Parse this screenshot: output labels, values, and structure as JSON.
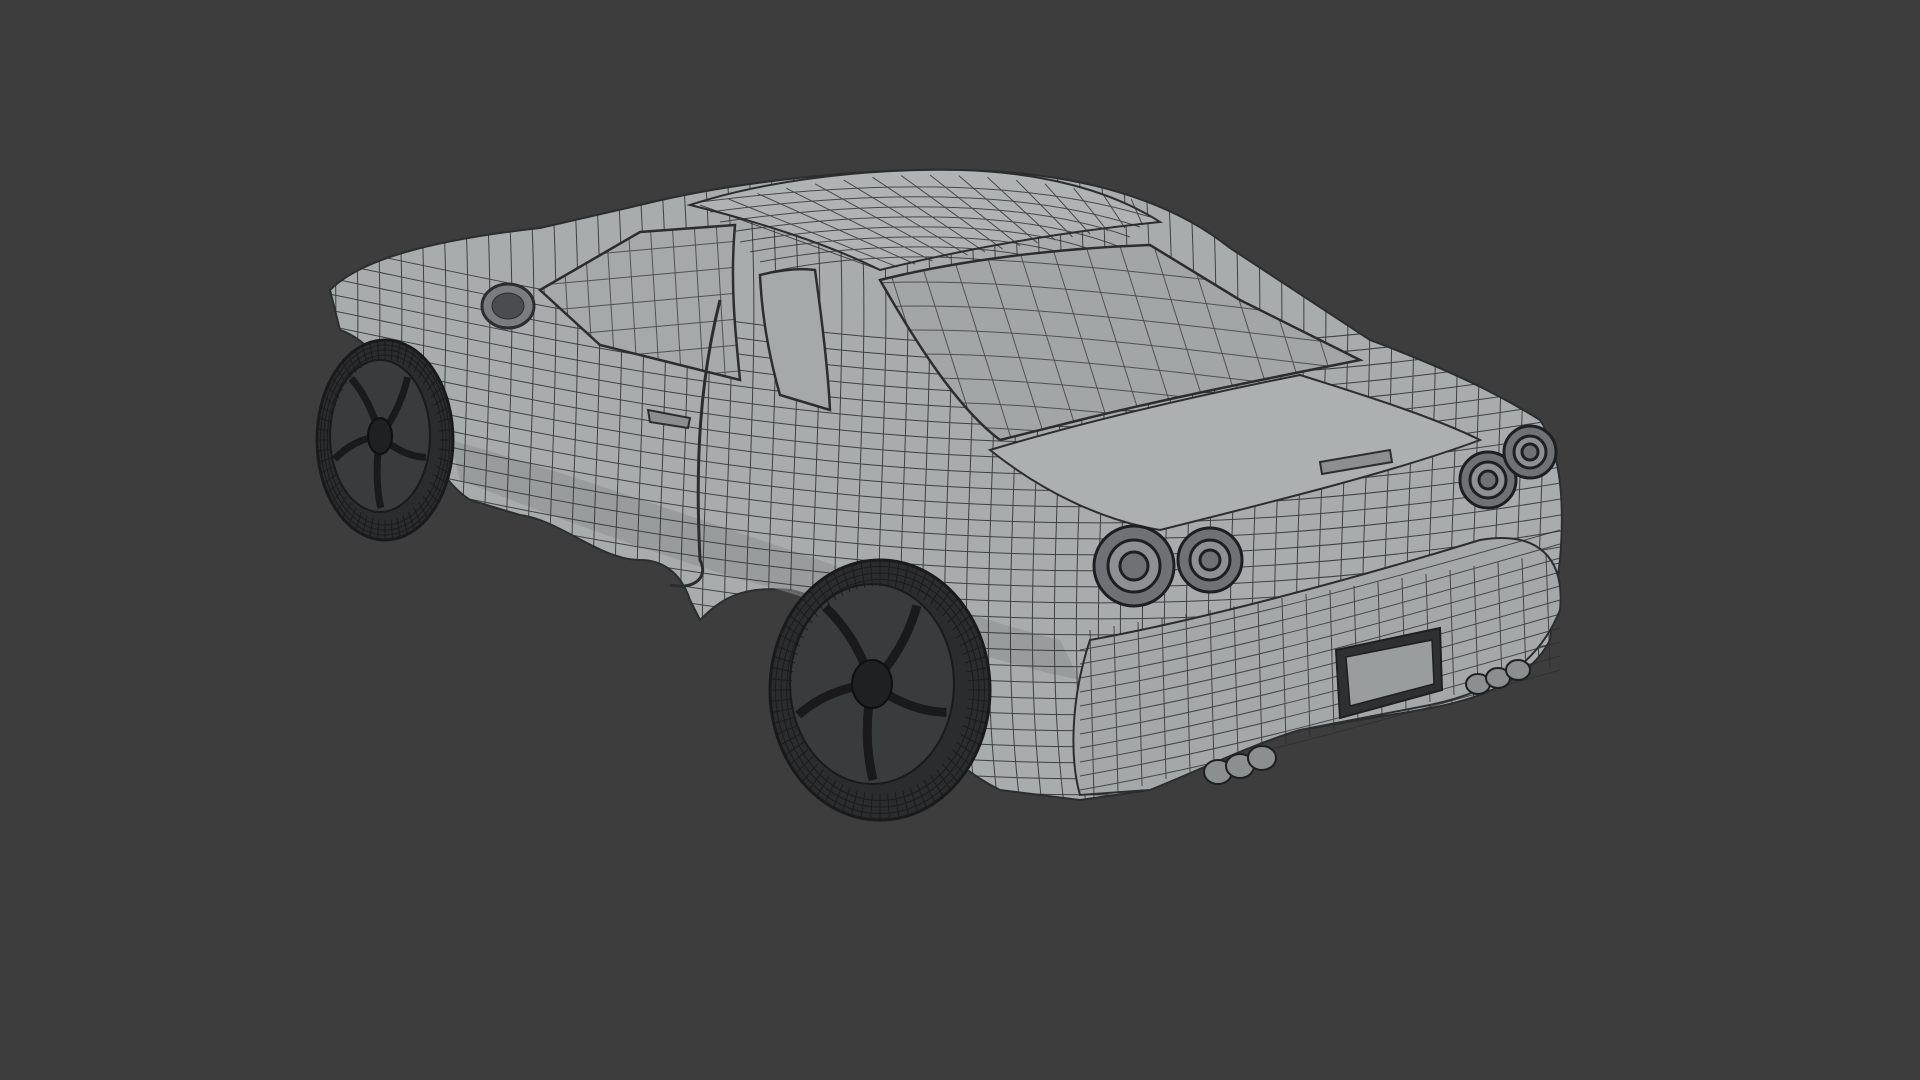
{
  "viewport": {
    "shading": "solid-wireframe",
    "background_color": "#3d3d3d",
    "model": {
      "subject": "car",
      "body_color": "#a9acac",
      "body_shadow_color": "#8c8f90",
      "wire_color": "#2c2d2f",
      "tire_color": "#2b2c2e",
      "rim_color": "#3a3b3d"
    }
  }
}
